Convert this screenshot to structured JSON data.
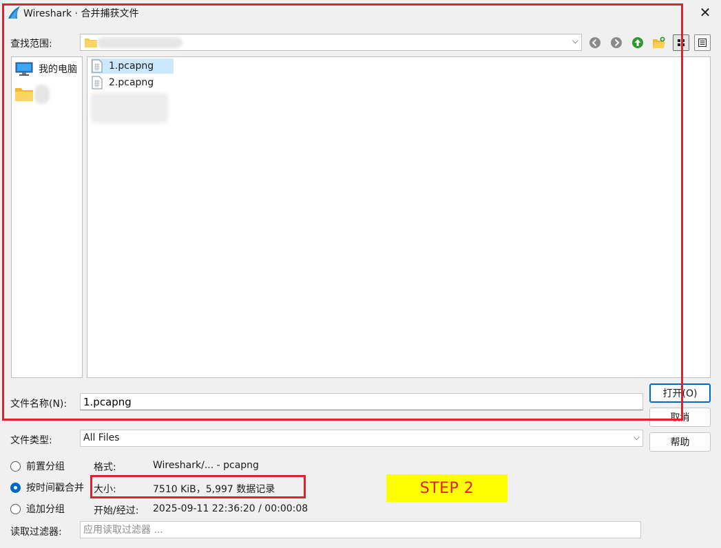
{
  "window": {
    "title": "Wireshark · 合并捕获文件",
    "close_symbol": "✕"
  },
  "look_in": {
    "label": "查找范围:",
    "dropdown_symbol": "⌵"
  },
  "toolbar": {
    "icons": [
      "back-icon",
      "forward-icon",
      "up-icon",
      "new-folder-icon",
      "icon-view-icon",
      "list-view-icon"
    ]
  },
  "sidebar": {
    "items": [
      {
        "label": "我的电脑",
        "icon": "computer-icon"
      }
    ]
  },
  "files": [
    {
      "name": "1.pcapng",
      "selected": true
    },
    {
      "name": "2.pcapng",
      "selected": false
    }
  ],
  "filename": {
    "label": "文件名称(N):",
    "value": "1.pcapng"
  },
  "filetype": {
    "label": "文件类型:",
    "value": "All Files"
  },
  "buttons": {
    "open": "打开(O)",
    "cancel": "取消",
    "help": "帮助"
  },
  "merge_options": [
    {
      "label": "前置分组",
      "checked": false
    },
    {
      "label": "按时间戳合并",
      "checked": true
    },
    {
      "label": "追加分组",
      "checked": false
    }
  ],
  "file_info": {
    "format_key": "格式:",
    "format_value": "Wireshark/... - pcapng",
    "size_key": "大小:",
    "size_value": "7510 KiB，5,997 数据记录",
    "start_key": "开始/经过:",
    "start_value": "2025-09-11 22:36:20 / 00:00:08"
  },
  "read_filter": {
    "label": "读取过滤器:",
    "placeholder": "应用读取过滤器 ..."
  },
  "annotation": {
    "step_label": "STEP 2",
    "highlight_color": "#e0202a",
    "label_bg": "#ffff00"
  }
}
